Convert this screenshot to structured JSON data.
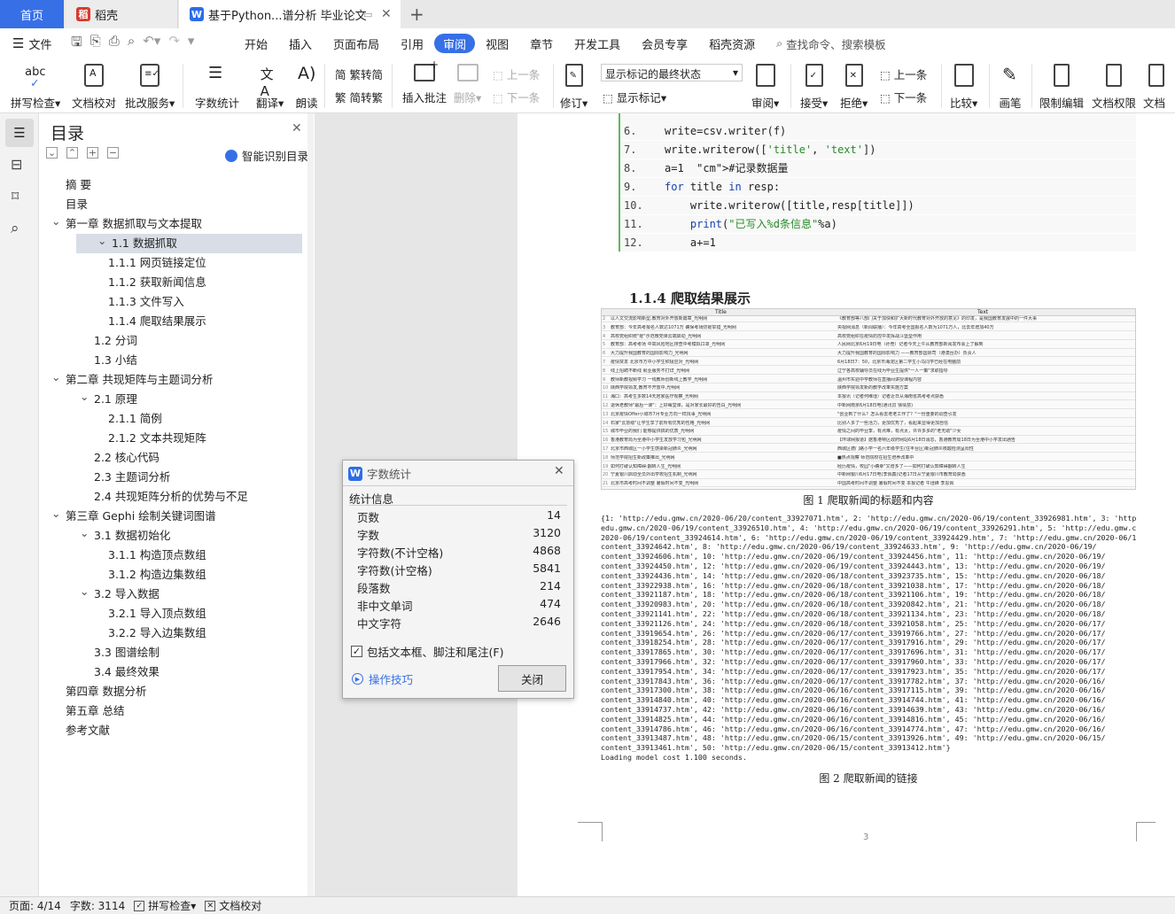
{
  "tabs": {
    "home": "首页",
    "wps": "稻壳",
    "doc": "基于Python...谱分析 毕业论文"
  },
  "menu": {
    "file": "文件",
    "items": [
      "开始",
      "插入",
      "页面布局",
      "引用",
      "审阅",
      "视图",
      "章节",
      "开发工具",
      "会员专享",
      "稻壳资源"
    ],
    "active_index": 4,
    "search": "查找命令、搜索模板"
  },
  "ribbon": {
    "spell": "拼写检查",
    "proof": "文档校对",
    "batch": "批改服务",
    "wordcount": "字数统计",
    "translate": "翻译",
    "read": "朗读",
    "trad": "繁转简",
    "simp": "简转繁",
    "insert_comment": "插入批注",
    "delete": "删除",
    "prev_comment": "上一条",
    "next_comment": "下一条",
    "revise": "修订",
    "markup_state": "显示标记的最终状态",
    "show_markup": "显示标记",
    "review": "审阅",
    "accept": "接受",
    "reject": "拒绝",
    "prev": "上一条",
    "next": "下一条",
    "compare": "比较",
    "pen": "画笔",
    "restrict": "限制编辑",
    "doc_perm": "文档权限",
    "doc_cert": "文档认"
  },
  "toc": {
    "title": "目录",
    "smart": "智能识别目录",
    "items": [
      {
        "text": "摘  要",
        "level": 0
      },
      {
        "text": "目录",
        "level": 0
      },
      {
        "text": "第一章  数据抓取与文本提取",
        "level": 0,
        "caret": true
      },
      {
        "text": "1.1 数据抓取",
        "level": 1,
        "caret": true,
        "selected": true
      },
      {
        "text": "1.1.1 网页链接定位",
        "level": 2
      },
      {
        "text": "1.1.2  获取新闻信息",
        "level": 2
      },
      {
        "text": "1.1.3  文件写入",
        "level": 2
      },
      {
        "text": "1.1.4  爬取结果展示",
        "level": 2
      },
      {
        "text": "1.2  分词",
        "level": 1
      },
      {
        "text": "1.3  小结",
        "level": 1
      },
      {
        "text": "第二章  共现矩阵与主题词分析",
        "level": 0,
        "caret": true
      },
      {
        "text": "2.1  原理",
        "level": 1,
        "caret": true
      },
      {
        "text": "2.1.1  简例",
        "level": 2
      },
      {
        "text": "2.1.2  文本共现矩阵",
        "level": 2
      },
      {
        "text": "2.2  核心代码",
        "level": 1
      },
      {
        "text": "2.3  主题词分析",
        "level": 1
      },
      {
        "text": "2.4  共现矩阵分析的优势与不足",
        "level": 1
      },
      {
        "text": "第三章  Gephi 绘制关键词图谱",
        "level": 0,
        "caret": true
      },
      {
        "text": "3.1  数据初始化",
        "level": 1,
        "caret": true
      },
      {
        "text": "3.1.1  构造顶点数组",
        "level": 2
      },
      {
        "text": "3.1.2  构造边集数组",
        "level": 2
      },
      {
        "text": "3.2  导入数据",
        "level": 1,
        "caret": true
      },
      {
        "text": "3.2.1  导入顶点数组",
        "level": 2
      },
      {
        "text": "3.2.2  导入边集数组",
        "level": 2
      },
      {
        "text": "3.3  图谱绘制",
        "level": 1
      },
      {
        "text": "3.4  最终效果",
        "level": 1
      },
      {
        "text": "第四章  数据分析",
        "level": 0
      },
      {
        "text": "第五章  总结",
        "level": 0
      },
      {
        "text": "参考文献",
        "level": 0
      }
    ]
  },
  "code": [
    {
      "n": "6.",
      "t": "write=csv.writer(f)"
    },
    {
      "n": "7.",
      "t": "write.writerow(['title', 'text'])"
    },
    {
      "n": "8.",
      "t": "a=1  #记录数据量"
    },
    {
      "n": "9.",
      "t": "for title in resp:"
    },
    {
      "n": "10.",
      "t": "    write.writerow([title,resp[title]])"
    },
    {
      "n": "11.",
      "t": "    print(\"已写入%d条信息\"%a)"
    },
    {
      "n": "12.",
      "t": "    a+=1"
    }
  ],
  "doc": {
    "heading": "1.1.4  爬取结果展示",
    "fig1_caption": "图 1  爬取新闻的标题和内容",
    "fig1_col_title": "Title",
    "fig1_col_text": "Text",
    "fig1_rows": [
      [
        "以人文交流影响新型,教育对外开放新篇章_光明网",
        "《教育部等八部门关于加快和扩大新时代教育对外开放的意见》的印发，是我国教育发展中的一件大事"
      ],
      [
        "教育部：今年高考报名人数达1071万 确保考场防疫举措_光明网",
        "央视网消息（新闻联播）：今年高考全国报名人数为1071万人，比去年增加40万"
      ],
      [
        "高校党组织统\"疫\"示范微党课云端启动_光明网",
        "高校党组织在疫情防控中发挥战斗堡垒作用"
      ],
      [
        "教育部：高考考场 中高风险地区排查中考模拟口罩_光明网",
        "人民网北京6月19日电（孙竞）记者今天上午从教育部新闻发布会上了解到"
      ],
      [
        "大力提升我国教育的国际影响力_光明网",
        "大力提升我国教育的国际影响力 ——教育部国际司（港澳台办）负责人"
      ],
      [
        "疫情突发 北京市方中小学生积极应对_光明网",
        "6月18日7：50，北京市海淀区第二学生小马同学已经在电脑前"
      ],
      [
        "线上招聘不断线 就业服务不打烊_光明网",
        "辽宁各高校辅导员在线为毕业生提供\"一人一策\"求职指导"
      ],
      [
        "教师新教视频学习 一线教师创新线上教学_光明网",
        "温州市实验中学教师在直播间讲授课程内容"
      ],
      [
        "陕西学院领发,教育不开放中,光明网",
        "陕西学院领发新的教学改革实施方案"
      ],
      [
        "海口：高考生多数14天居家医疗观察_光明网",
        "本报讯（记者何维瑾）记者近日从海南省高考考点获悉"
      ],
      [
        "退休老教师\"最后一课\"：上好每堂课，是对家长最好的告白_光明网",
        "中新网南京6月18日电(通讯员 徐倩慧)"
      ],
      [
        "北京疫情Offer小城市7月专业方向一样找事_光明网",
        "\"创业到了什么？怎么看去老老工作了？\"一份重要的调查引发"
      ],
      [
        "石家\"云慧级\"让学生享了前所有优秀的性格_光明网",
        "比别人多了一些活力，更加优秀了，看起来显得更加自信"
      ],
      [
        "城市毕业的我们 能够提供搞的优质_光明网",
        "疫情之间的毕业季，有点难，有点太，许许多多的\"老无助\"少女"
      ],
      [
        "香港教育局为全港中小学生发放学习包_光明网",
        "【环球网报道】据香港特区政府网站6月18日消息，香港教育局18日为全港中小学发出通告"
      ],
      [
        "北京市西城区一小学生感染新冠肺炎_光明网",
        "西城区德门路小学一名六年级学生(住丰台区)新冠肺炎核酸检测呈阳性"
      ],
      [
        "师范学院招生新政策推出_光明网",
        "■热点观察 师范院校在招生培养改革中"
      ],
      [
        "如何打破认知障碍:翻转人生_光明网",
        "经历疫情，校园\"小确幸\"又增多了——如何打破认知障碍翻转人生"
      ],
      [
        "宁夏银川启动全员外出学校招生机制_光明网",
        "中新网银川6月17日电(李佩鑫)记者17日从宁夏银川市教育局获悉"
      ],
      [
        "北京市高考时间不调整 暑假时间不变_光明网",
        "中国高考时间不调整 暑假时间不变 本报记者 牛瑾蜂 李思佩"
      ]
    ],
    "fig2_caption": "图 2  爬取新闻的链接",
    "fig2_lines": [
      "{1: 'http://edu.gmw.cn/2020-06/20/content_33927071.htm', 2: 'http://edu.gmw.cn/2020-06/19/content_33926981.htm', 3: 'http://",
      "edu.gmw.cn/2020-06/19/content_33926510.htm', 4: 'http://edu.gmw.cn/2020-06/19/content_33926291.htm', 5: 'http://edu.gmw.cn/",
      "2020-06/19/content_33924614.htm', 6: 'http://edu.gmw.cn/2020-06/19/content_33924429.htm', 7: 'http://edu.gmw.cn/2020-06/19/",
      "content_33924642.htm', 8: 'http://edu.gmw.cn/2020-06/19/content_33924633.htm', 9: 'http://edu.gmw.cn/2020-06/19/",
      "content_33924606.htm', 10: 'http://edu.gmw.cn/2020-06/19/content_33924456.htm', 11: 'http://edu.gmw.cn/2020-06/19/",
      "content_33924450.htm', 12: 'http://edu.gmw.cn/2020-06/19/content_33924443.htm', 13: 'http://edu.gmw.cn/2020-06/19/",
      "content_33924436.htm', 14: 'http://edu.gmw.cn/2020-06/18/content_33923735.htm', 15: 'http://edu.gmw.cn/2020-06/18/",
      "content_33922938.htm', 16: 'http://edu.gmw.cn/2020-06/18/content_33921038.htm', 17: 'http://edu.gmw.cn/2020-06/18/",
      "content_33921187.htm', 18: 'http://edu.gmw.cn/2020-06/18/content_33921106.htm', 19: 'http://edu.gmw.cn/2020-06/18/",
      "content_33920983.htm', 20: 'http://edu.gmw.cn/2020-06/18/content_33920842.htm', 21: 'http://edu.gmw.cn/2020-06/18/",
      "content_33921141.htm', 22: 'http://edu.gmw.cn/2020-06/18/content_33921134.htm', 23: 'http://edu.gmw.cn/2020-06/18/",
      "content_33921126.htm', 24: 'http://edu.gmw.cn/2020-06/18/content_33921058.htm', 25: 'http://edu.gmw.cn/2020-06/17/",
      "content_33919654.htm', 26: 'http://edu.gmw.cn/2020-06/17/content_33919766.htm', 27: 'http://edu.gmw.cn/2020-06/17/",
      "content_33918254.htm', 28: 'http://edu.gmw.cn/2020-06/17/content_33917916.htm', 29: 'http://edu.gmw.cn/2020-06/17/",
      "content_33917865.htm', 30: 'http://edu.gmw.cn/2020-06/17/content_33917696.htm', 31: 'http://edu.gmw.cn/2020-06/17/",
      "content_33917966.htm', 32: 'http://edu.gmw.cn/2020-06/17/content_33917960.htm', 33: 'http://edu.gmw.cn/2020-06/17/",
      "content_33917954.htm', 34: 'http://edu.gmw.cn/2020-06/17/content_33917923.htm', 35: 'http://edu.gmw.cn/2020-06/17/",
      "content_33917843.htm', 36: 'http://edu.gmw.cn/2020-06/17/content_33917782.htm', 37: 'http://edu.gmw.cn/2020-06/16/",
      "content_33917300.htm', 38: 'http://edu.gmw.cn/2020-06/16/content_33917115.htm', 39: 'http://edu.gmw.cn/2020-06/16/",
      "content_33914840.htm', 40: 'http://edu.gmw.cn/2020-06/16/content_33914744.htm', 41: 'http://edu.gmw.cn/2020-06/16/",
      "content_33914737.htm', 42: 'http://edu.gmw.cn/2020-06/16/content_33914639.htm', 43: 'http://edu.gmw.cn/2020-06/16/",
      "content_33914825.htm', 44: 'http://edu.gmw.cn/2020-06/16/content_33914816.htm', 45: 'http://edu.gmw.cn/2020-06/16/",
      "content_33914786.htm', 46: 'http://edu.gmw.cn/2020-06/16/content_33914774.htm', 47: 'http://edu.gmw.cn/2020-06/16/",
      "content_33913487.htm', 48: 'http://edu.gmw.cn/2020-06/15/content_33913926.htm', 49: 'http://edu.gmw.cn/2020-06/15/",
      "content_33913461.htm', 50: 'http://edu.gmw.cn/2020-06/15/content_33913412.htm'}",
      "Loading model cost 1.100 seconds."
    ],
    "page_number": "3"
  },
  "dialog": {
    "title": "字数统计",
    "section": "统计信息",
    "rows": [
      {
        "label": "页数",
        "value": "14"
      },
      {
        "label": "字数",
        "value": "3120"
      },
      {
        "label": "字符数(不计空格)",
        "value": "4868"
      },
      {
        "label": "字符数(计空格)",
        "value": "5841"
      },
      {
        "label": "段落数",
        "value": "214"
      },
      {
        "label": "非中文单词",
        "value": "474"
      },
      {
        "label": "中文字符",
        "value": "2646"
      }
    ],
    "checkbox": "包括文本框、脚注和尾注(F)",
    "tips": "操作技巧",
    "close": "关闭"
  },
  "status": {
    "page": "页面: 4/14",
    "words": "字数: 3114",
    "spell": "拼写检查",
    "proof": "文档校对"
  },
  "colors": {
    "accent": "#3770e6",
    "tab_bg": "#e8e8e8"
  }
}
